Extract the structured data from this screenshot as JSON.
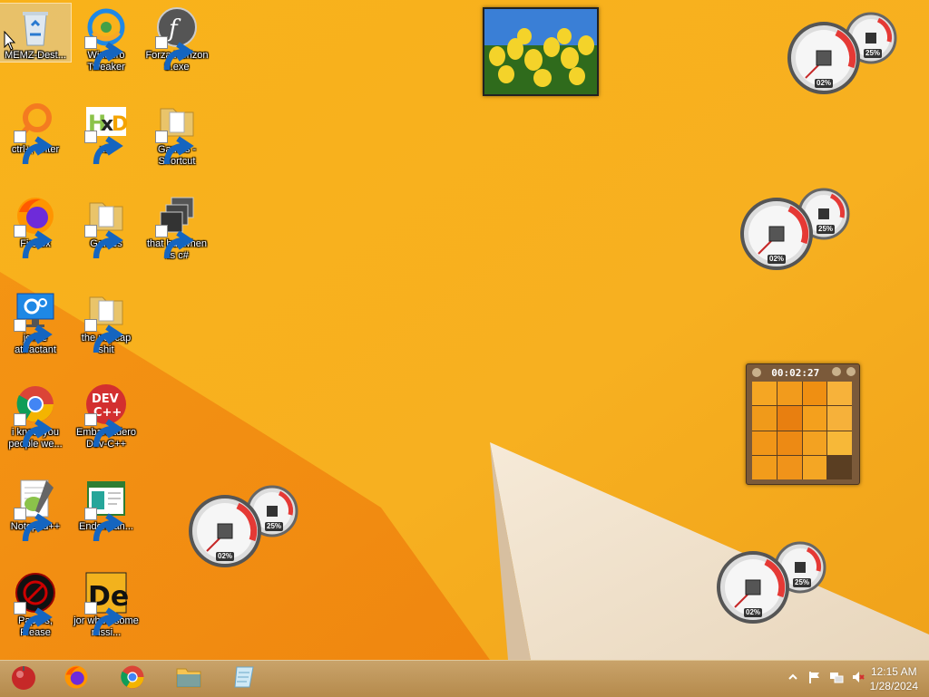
{
  "desktop_icons": [
    {
      "label": "MEMZ-Dest...",
      "icon": "recycle-bin-icon"
    },
    {
      "label": "Winaero Tweaker",
      "icon": "winaero-icon"
    },
    {
      "label": "Forza Horizon 5.exe",
      "icon": "flash-player-icon"
    },
    {
      "label": "ctrl+, enter",
      "icon": "search-tool-icon"
    },
    {
      "label": "xD",
      "icon": "hxd-icon"
    },
    {
      "label": "Games - Shortcut",
      "icon": "folder-icon"
    },
    {
      "label": "Firefox",
      "icon": "firefox-icon"
    },
    {
      "label": "Games",
      "icon": "folder-icon"
    },
    {
      "label": "that but when its c#",
      "icon": "stacked-windows-icon"
    },
    {
      "label": "jorkle attractant",
      "icon": "settings-monitor-icon"
    },
    {
      "label": "the popcap shit",
      "icon": "folder-icon"
    },
    {
      "label": "i know you people we...",
      "icon": "chrome-icon"
    },
    {
      "label": "Embarcadero Dev-C++",
      "icon": "devcpp-icon"
    },
    {
      "label": "Notepad++",
      "icon": "notepadpp-icon"
    },
    {
      "label": "Enderman...",
      "icon": "window-app-icon"
    },
    {
      "label": "Papers, Please",
      "icon": "papers-please-icon"
    },
    {
      "label": "jor when some russi...",
      "icon": "de-icon"
    }
  ],
  "meters": [
    {
      "cpu": "02%",
      "mem": "25%"
    },
    {
      "cpu": "02%",
      "mem": "25%"
    },
    {
      "cpu": "02%",
      "mem": "25%"
    },
    {
      "cpu": "02%",
      "mem": "25%"
    }
  ],
  "puzzle": {
    "time": "00:02:27"
  },
  "taskbar": {
    "items": [
      "start-orb-icon",
      "firefox-icon",
      "chrome-icon",
      "file-explorer-icon",
      "notepad-icon"
    ]
  },
  "tray": {
    "icons": [
      "chevron-up-icon",
      "flag-icon",
      "network-icon",
      "volume-muted-icon"
    ]
  },
  "clock": {
    "time": "12:15 AM",
    "date": "1/28/2024"
  },
  "colors": {
    "wallpaper": "#f7b21b",
    "taskbar": "#c9a36a"
  }
}
